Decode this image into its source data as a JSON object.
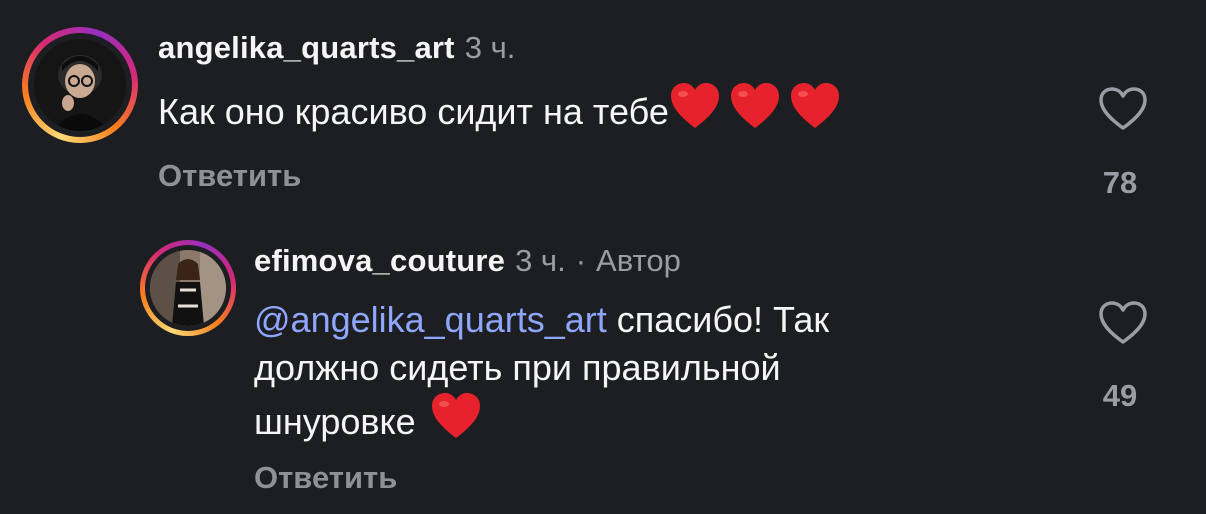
{
  "comments": [
    {
      "username": "angelika_quarts_art",
      "time": "3 ч.",
      "text": "Как оно красиво сидит на тебе",
      "emoji_count": 3,
      "reply_label": "Ответить",
      "likes": "78"
    },
    {
      "username": "efimova_couture",
      "time": "3 ч.",
      "separator": "·",
      "author_badge": "Автор",
      "mention": "@angelika_quarts_art",
      "text_line1": " спасибо! Так",
      "text_line2": "должно сидеть при правильной",
      "text_line3": "шнуровке",
      "emoji_count": 1,
      "reply_label": "Ответить",
      "likes": "49"
    }
  ],
  "icons": {
    "heart": "heart-outline-icon",
    "emoji": "red-heart-emoji"
  },
  "colors": {
    "background": "#1c1e21",
    "mention": "#8fa6ff",
    "muted": "#9a9ea4",
    "heart_emoji": "#e6232c"
  }
}
